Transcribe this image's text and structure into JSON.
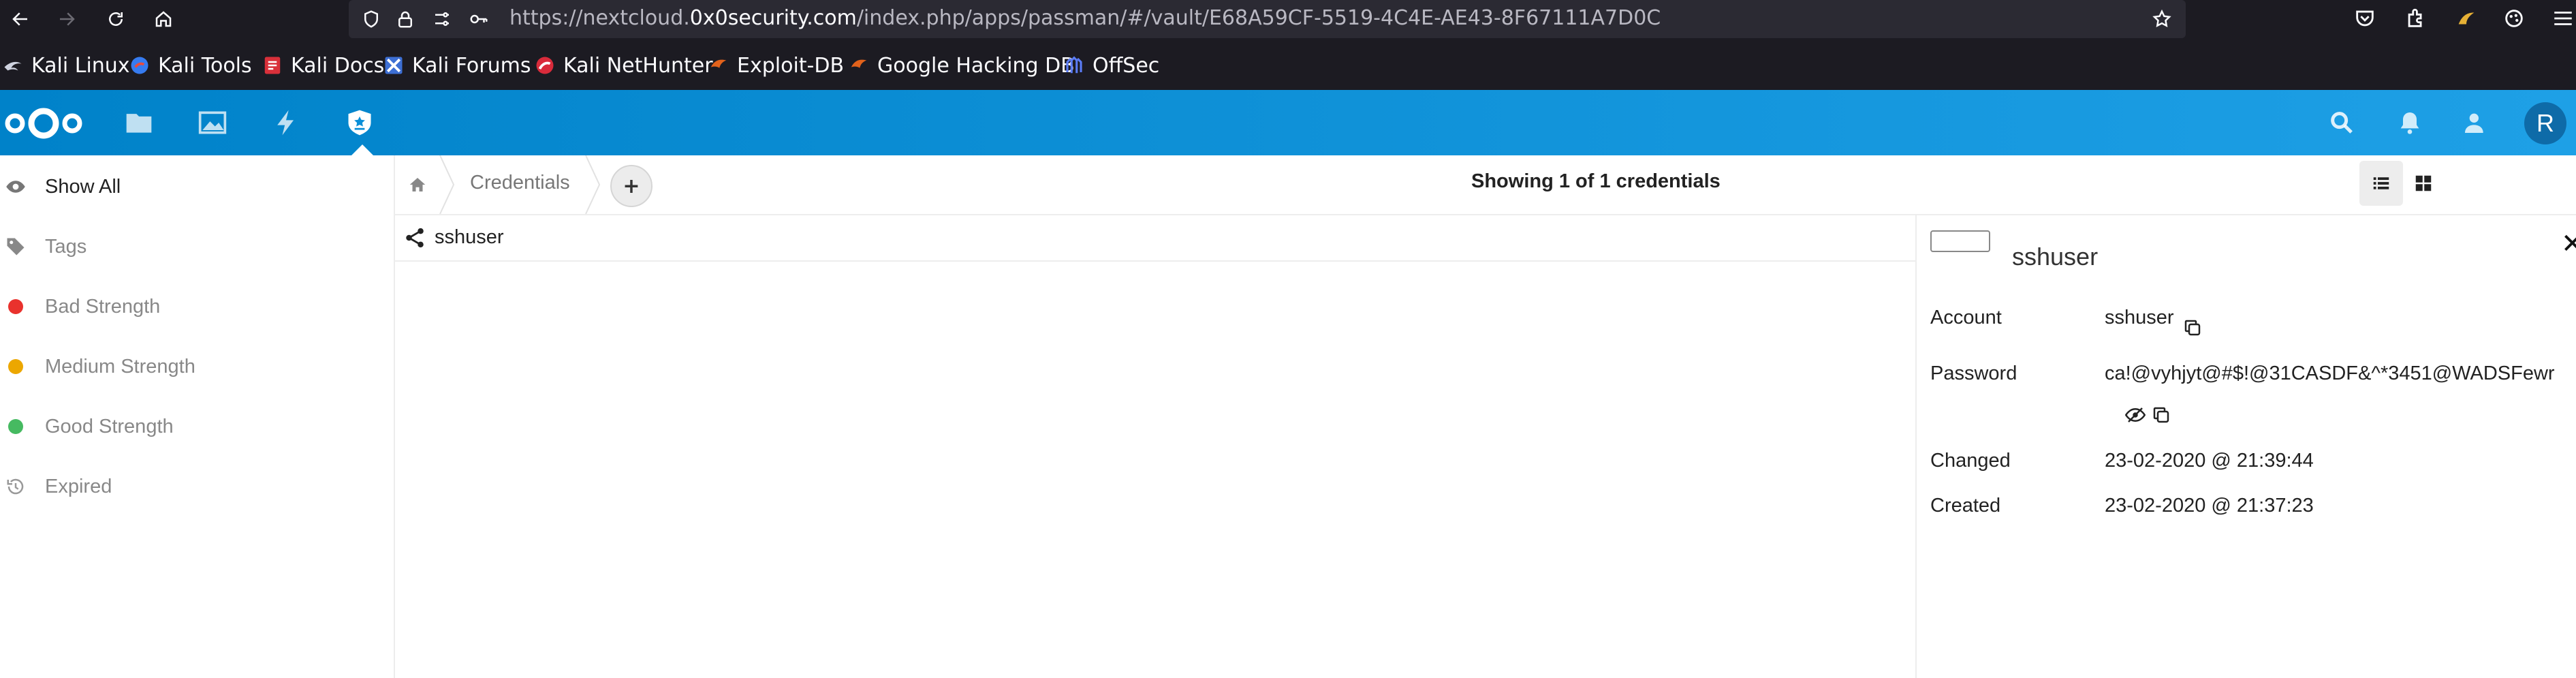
{
  "browser": {
    "url_prefix": "https://nextcloud.",
    "url_domain": "0x0security.com",
    "url_suffix": "/index.php/apps/passman/#/vault/E68A59CF-5519-4C4E-AE43-8F67111A7D0C"
  },
  "bookmarks": [
    {
      "label": "Kali Linux",
      "icon": "kali-dragon-icon"
    },
    {
      "label": "Kali Tools",
      "icon": "kali-tools-icon"
    },
    {
      "label": "Kali Docs",
      "icon": "kali-docs-icon"
    },
    {
      "label": "Kali Forums",
      "icon": "kali-forums-icon"
    },
    {
      "label": "Kali NetHunter",
      "icon": "nethunter-icon"
    },
    {
      "label": "Exploit-DB",
      "icon": "exploit-db-icon"
    },
    {
      "label": "Google Hacking DB",
      "icon": "ghdb-icon"
    },
    {
      "label": "OffSec",
      "icon": "offsec-icon"
    }
  ],
  "header": {
    "avatar_initial": "R",
    "apps": [
      "files-icon",
      "photos-icon",
      "activity-icon",
      "passman-icon"
    ]
  },
  "sidebar": {
    "items": [
      {
        "label": "Show All",
        "icon": "eye-icon"
      },
      {
        "label": "Tags",
        "icon": "tag-icon"
      },
      {
        "label": "Bad Strength",
        "dot_color": "#e9322d"
      },
      {
        "label": "Medium Strength",
        "dot_color": "#eca700"
      },
      {
        "label": "Good Strength",
        "dot_color": "#46ba61"
      },
      {
        "label": "Expired",
        "icon": "history-icon"
      }
    ]
  },
  "controls": {
    "breadcrumb": "Credentials",
    "add_label": "+",
    "count_text": "Showing 1 of 1 credentials"
  },
  "list": {
    "rows": [
      {
        "label": "sshuser",
        "icon": "share-icon"
      }
    ]
  },
  "detail": {
    "title": "sshuser",
    "close": "✕",
    "fields": {
      "account_label": "Account",
      "account_value": "sshuser",
      "password_label": "Password",
      "password_value": "ca!@vyhjyt@#$!@31CASDF&^*3451@WADSFewr",
      "changed_label": "Changed",
      "changed_value": "23-02-2020 @ 21:39:44",
      "created_label": "Created",
      "created_value": "23-02-2020 @ 21:37:23"
    }
  }
}
